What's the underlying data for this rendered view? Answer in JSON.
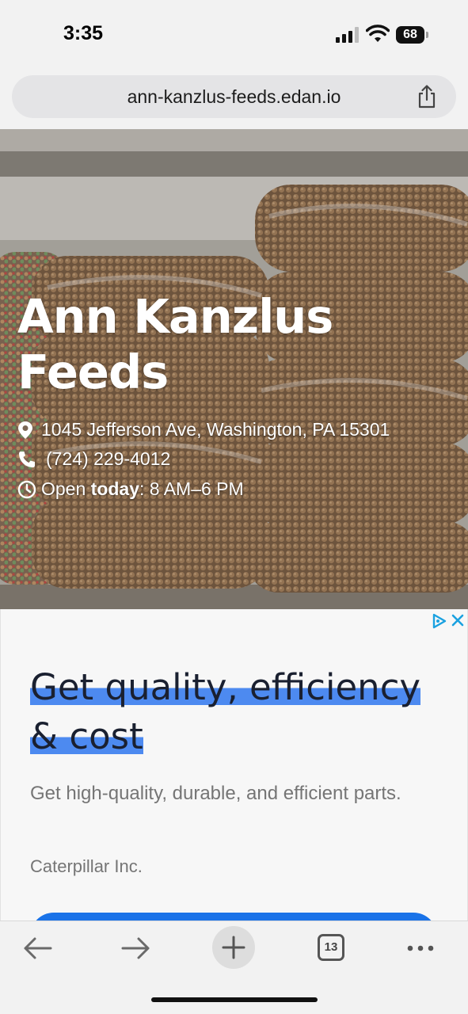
{
  "status_bar": {
    "time": "3:35",
    "battery": "68"
  },
  "browser": {
    "url": "ann-kanzlus-feeds.edan.io",
    "tab_count": "13"
  },
  "business": {
    "name": "Ann Kanzlus Feeds",
    "address": "1045 Jefferson Ave, Washington, PA 15301",
    "phone": "(724) 229-4012",
    "hours_prefix": "Open ",
    "hours_day": "today",
    "hours_suffix": ": 8 AM–6 PM"
  },
  "ad": {
    "headline_line1": "Get quality, efficiency",
    "headline_line2": "& cost",
    "description": "Get high-quality, durable, and efficient parts.",
    "advertiser": "Caterpillar Inc."
  },
  "icons": [
    "location-pin-icon",
    "phone-icon",
    "clock-icon",
    "share-icon",
    "back-arrow-icon",
    "forward-arrow-icon",
    "plus-icon",
    "more-icon",
    "ad-choices-icon",
    "close-icon"
  ],
  "colors": {
    "accent": "#1a73e8",
    "highlight": "#4d8af0"
  }
}
